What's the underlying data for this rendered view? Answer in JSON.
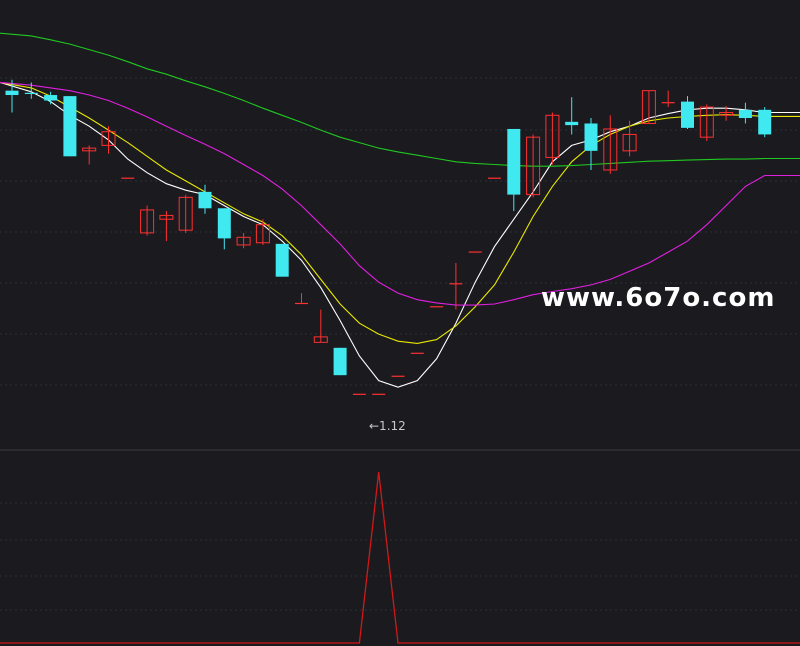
{
  "chart_data": [
    {
      "type": "candlestick",
      "candles": [
        {
          "open": 5.8,
          "close": 5.72,
          "high": 6.0,
          "low": 5.4
        },
        {
          "open": 5.75,
          "close": 5.73,
          "high": 5.95,
          "low": 5.65
        },
        {
          "open": 5.72,
          "close": 5.62,
          "high": 5.78,
          "low": 5.55
        },
        {
          "open": 5.7,
          "close": 4.6,
          "high": 5.7,
          "low": 4.6
        },
        {
          "open": 4.7,
          "close": 4.75,
          "high": 4.8,
          "low": 4.45
        },
        {
          "open": 4.8,
          "close": 5.05,
          "high": 5.15,
          "low": 4.65
        },
        {
          "open": 4.2,
          "close": 4.2,
          "high": 4.2,
          "low": 4.2
        },
        {
          "open": 3.2,
          "close": 3.62,
          "high": 3.7,
          "low": 3.15
        },
        {
          "open": 3.45,
          "close": 3.52,
          "high": 3.6,
          "low": 3.05
        },
        {
          "open": 3.25,
          "close": 3.85,
          "high": 3.9,
          "low": 3.2
        },
        {
          "open": 3.95,
          "close": 3.65,
          "high": 4.08,
          "low": 3.55
        },
        {
          "open": 3.65,
          "close": 3.1,
          "high": 3.65,
          "low": 2.9
        },
        {
          "open": 2.98,
          "close": 3.12,
          "high": 3.2,
          "low": 2.92
        },
        {
          "open": 3.02,
          "close": 3.35,
          "high": 3.45,
          "low": 2.98
        },
        {
          "open": 3.0,
          "close": 2.4,
          "high": 3.0,
          "low": 2.4
        },
        {
          "open": 1.91,
          "close": 1.91,
          "high": 2.1,
          "low": 1.91
        },
        {
          "open": 1.2,
          "close": 1.3,
          "high": 1.8,
          "low": 1.2
        },
        {
          "open": 1.1,
          "close": 0.6,
          "high": 1.1,
          "low": 0.6
        },
        {
          "open": 0.25,
          "close": 0.25,
          "high": 0.25,
          "low": 0.25
        },
        {
          "open": 0.25,
          "close": 0.25,
          "high": 0.25,
          "low": 0.25
        },
        {
          "open": 0.58,
          "close": 0.58,
          "high": 0.58,
          "low": 0.58
        },
        {
          "open": 1.0,
          "close": 1.0,
          "high": 1.0,
          "low": 1.0
        },
        {
          "open": 1.85,
          "close": 1.85,
          "high": 1.85,
          "low": 1.85
        },
        {
          "open": 2.27,
          "close": 2.27,
          "high": 2.65,
          "low": 1.8
        },
        {
          "open": 2.85,
          "close": 2.85,
          "high": 2.85,
          "low": 2.85
        },
        {
          "open": 4.2,
          "close": 4.2,
          "high": 4.2,
          "low": 4.2
        },
        {
          "open": 5.1,
          "close": 3.9,
          "high": 5.1,
          "low": 3.6
        },
        {
          "open": 3.9,
          "close": 4.95,
          "high": 5.0,
          "low": 3.85
        },
        {
          "open": 4.58,
          "close": 5.35,
          "high": 5.4,
          "low": 4.45
        },
        {
          "open": 5.23,
          "close": 5.17,
          "high": 5.68,
          "low": 5.0
        },
        {
          "open": 5.2,
          "close": 4.7,
          "high": 5.3,
          "low": 4.35
        },
        {
          "open": 4.35,
          "close": 5.1,
          "high": 5.35,
          "low": 4.28
        },
        {
          "open": 4.7,
          "close": 5.0,
          "high": 5.25,
          "low": 4.6
        },
        {
          "open": 5.2,
          "close": 5.8,
          "high": 5.8,
          "low": 5.2
        },
        {
          "open": 5.58,
          "close": 5.58,
          "high": 5.8,
          "low": 5.5
        },
        {
          "open": 5.6,
          "close": 5.12,
          "high": 5.7,
          "low": 5.1
        },
        {
          "open": 4.95,
          "close": 5.5,
          "high": 5.55,
          "low": 4.88
        },
        {
          "open": 5.35,
          "close": 5.4,
          "high": 5.52,
          "low": 5.25
        },
        {
          "open": 5.45,
          "close": 5.3,
          "high": 5.58,
          "low": 5.2
        },
        {
          "open": 5.45,
          "close": 5.0,
          "high": 5.5,
          "low": 4.95
        }
      ],
      "ma_lines": [
        {
          "color": "#ffffff",
          "values": [
            5.95,
            5.78,
            5.6,
            5.35,
            5.15,
            4.9,
            4.55,
            4.3,
            4.1,
            3.98,
            3.9,
            3.7,
            3.5,
            3.35,
            3.05,
            2.7,
            2.2,
            1.6,
            0.95,
            0.5,
            0.38,
            0.5,
            0.9,
            1.55,
            2.3,
            2.95,
            3.45,
            3.95,
            4.5,
            4.8,
            4.9,
            5.05,
            5.15,
            5.3,
            5.38,
            5.45,
            5.48,
            5.48,
            5.45,
            5.4
          ]
        },
        {
          "color": "#e8e800",
          "values": [
            5.95,
            5.85,
            5.7,
            5.5,
            5.3,
            5.08,
            4.85,
            4.6,
            4.35,
            4.15,
            3.95,
            3.75,
            3.55,
            3.4,
            3.15,
            2.8,
            2.35,
            1.9,
            1.55,
            1.35,
            1.22,
            1.18,
            1.25,
            1.5,
            1.85,
            2.25,
            2.85,
            3.5,
            4.05,
            4.5,
            4.8,
            5.0,
            5.15,
            5.25,
            5.3,
            5.33,
            5.35,
            5.36,
            5.35,
            5.33
          ]
        },
        {
          "color": "#e020e0",
          "values": [
            5.95,
            5.9,
            5.85,
            5.8,
            5.72,
            5.62,
            5.48,
            5.32,
            5.15,
            4.98,
            4.82,
            4.65,
            4.45,
            4.25,
            4.0,
            3.7,
            3.35,
            3.0,
            2.6,
            2.3,
            2.1,
            1.98,
            1.92,
            1.88,
            1.88,
            1.9,
            1.98,
            2.07,
            2.13,
            2.18,
            2.25,
            2.35,
            2.5,
            2.65,
            2.85,
            3.05,
            3.35,
            3.7,
            4.05,
            4.25
          ]
        },
        {
          "color": "#20c820",
          "values": [
            6.85,
            6.8,
            6.73,
            6.65,
            6.55,
            6.45,
            6.33,
            6.2,
            6.1,
            5.98,
            5.87,
            5.75,
            5.62,
            5.48,
            5.35,
            5.22,
            5.08,
            4.95,
            4.85,
            4.75,
            4.68,
            4.62,
            4.56,
            4.5,
            4.47,
            4.45,
            4.43,
            4.42,
            4.42,
            4.43,
            4.45,
            4.47,
            4.49,
            4.51,
            4.52,
            4.53,
            4.54,
            4.55,
            4.55,
            4.56
          ]
        }
      ],
      "colors": {
        "up": "#ff3030",
        "down": "#40e8f0",
        "grid": "#2c3038",
        "divider": "#3a3d45"
      }
    },
    {
      "type": "line",
      "color": "#d01818",
      "values": [
        0,
        0,
        0,
        0,
        0,
        0,
        0,
        0,
        0,
        0,
        0,
        0,
        0,
        0,
        0,
        0,
        0,
        0,
        0,
        1,
        0,
        0,
        0,
        0,
        0,
        0,
        0,
        0,
        0,
        0,
        0,
        0,
        0,
        0,
        0,
        0,
        0,
        0,
        0,
        0
      ]
    }
  ],
  "annotations": {
    "min_label": "←1.12",
    "watermark": "www.6o7o.com"
  }
}
